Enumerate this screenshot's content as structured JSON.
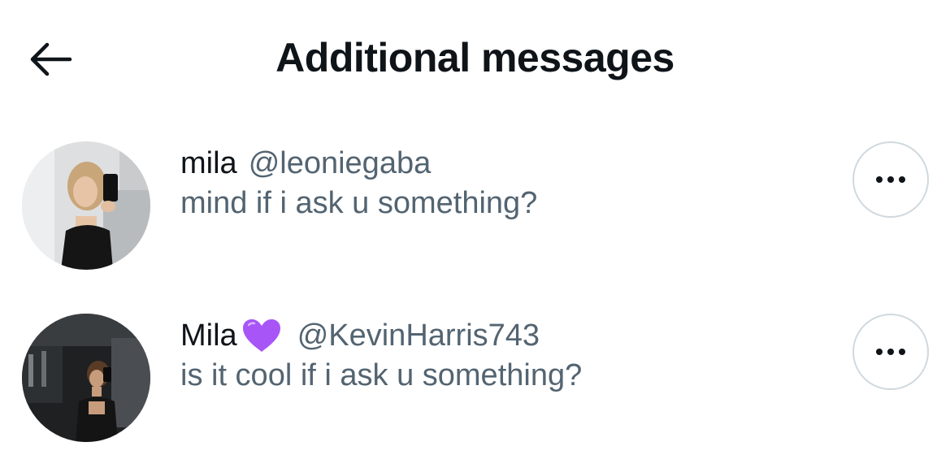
{
  "header": {
    "title": "Additional messages",
    "back_icon": "arrow-left-icon"
  },
  "requests": [
    {
      "display_name": "mila",
      "emoji": "",
      "handle": "@leoniegaba",
      "preview": "mind if i ask u something?",
      "more_icon": "more-horizontal-icon"
    },
    {
      "display_name": "Mila",
      "emoji": "purple-heart-icon",
      "handle": "@KevinHarris743",
      "preview": "is it cool if i ask u something?",
      "more_icon": "more-horizontal-icon"
    }
  ],
  "colors": {
    "text_primary": "#0f1419",
    "text_secondary": "#536471",
    "border": "#cfd9de",
    "heart": "#a855f7"
  }
}
